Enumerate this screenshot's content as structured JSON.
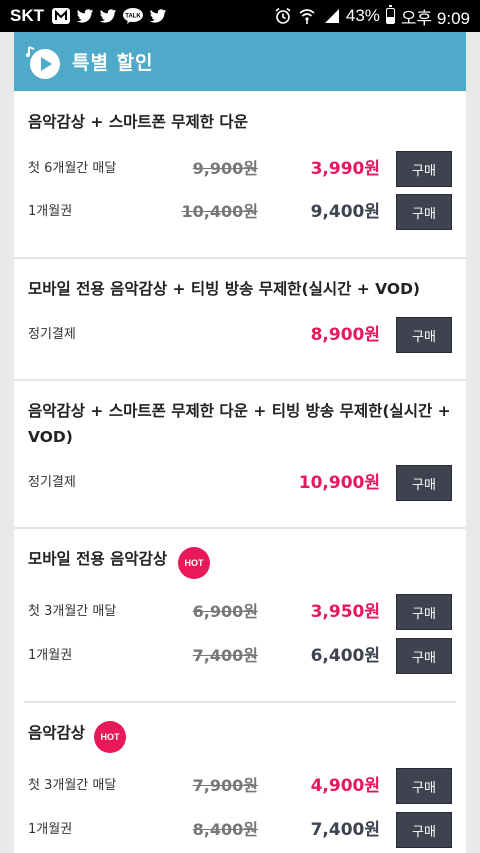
{
  "status_bar": {
    "carrier": "SKT",
    "talk_label": "TALK",
    "battery_text": "43%",
    "battery_level": 0.43,
    "time": "오후 9:09"
  },
  "header": {
    "title": "특별 할인"
  },
  "sections": [
    {
      "title": "음악감상 + 스마트폰 무제한 다운",
      "rows": [
        {
          "label": "첫 6개월간 매달",
          "original": "9,900원",
          "price": "3,990원",
          "buy": "구매"
        },
        {
          "label": "1개월권",
          "original": "10,400원",
          "price": "9,400원",
          "buy": "구매"
        }
      ]
    },
    {
      "title": "모바일 전용 음악감상 + 티빙 방송 무제한(실시간 + VOD)",
      "rows": [
        {
          "label": "정기결제",
          "price": "8,900원",
          "buy": "구매"
        }
      ]
    },
    {
      "title_line1": "음악감상 + 스마트폰 무제한 다운 + 티빙 방송 무제한(실시간 +",
      "title_line2": "VOD)",
      "rows": [
        {
          "label": "정기결제",
          "price": "10,900원",
          "buy": "구매"
        }
      ]
    },
    {
      "title": "모바일 전용 음악감상",
      "badge": "HOT",
      "rows": [
        {
          "label": "첫 3개월간 매달",
          "original": "6,900원",
          "price": "3,950원",
          "buy": "구매"
        },
        {
          "label": "1개월권",
          "original": "7,400원",
          "price": "6,400원",
          "buy": "구매"
        }
      ]
    },
    {
      "title": "음악감상",
      "badge": "HOT",
      "rows": [
        {
          "label": "첫 3개월간 매달",
          "original": "7,900원",
          "price": "4,900원",
          "buy": "구매"
        },
        {
          "label": "1개월권",
          "original": "8,400원",
          "price": "7,400원",
          "buy": "구매"
        }
      ]
    }
  ]
}
